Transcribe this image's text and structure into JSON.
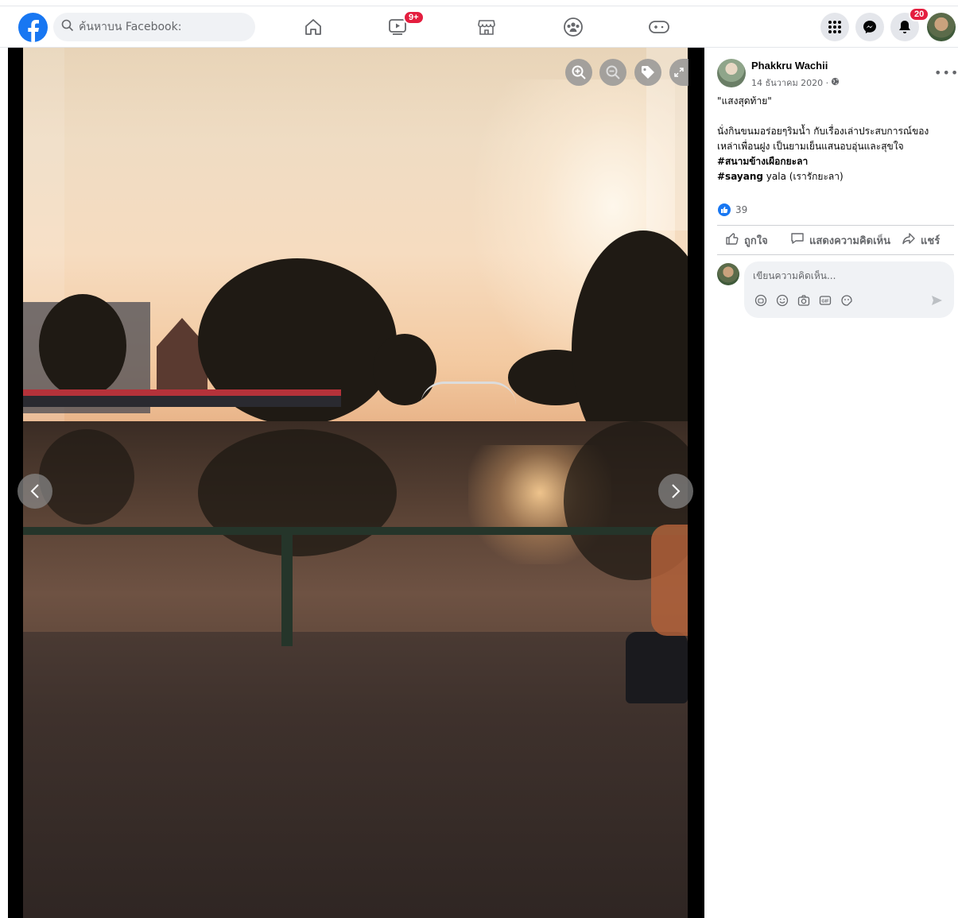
{
  "topbar": {
    "search_placeholder": "ค้นหาบน Facebook:",
    "watch_badge": "9+",
    "notifications_badge": "20",
    "accent_color": "#1877f2",
    "badge_color": "#e41e3f",
    "nav_icons": [
      "home-icon",
      "watch-icon",
      "marketplace-icon",
      "groups-icon",
      "gaming-icon"
    ],
    "right_icons": [
      "menu-grid-icon",
      "messenger-icon",
      "bell-icon",
      "profile-avatar"
    ]
  },
  "viewer": {
    "tools": [
      "zoom-in-icon",
      "zoom-out-icon",
      "tag-icon",
      "fullscreen-icon"
    ],
    "nav": [
      "previous-arrow-icon",
      "next-arrow-icon"
    ]
  },
  "post": {
    "author": "Phakkru Wachii",
    "date": "14 ธันวาคม 2020 ·",
    "title_line": "\"แสงสุดท้าย\"",
    "body_line1": "นั่งกินขนมอร่อยๆริมน้ำ กับเรื่องเล่าประสบการณ์ของ",
    "body_line2": "เหล่าเพื่อนฝูง เป็นยามเย็นแสนอบอุ่นและสุขใจ",
    "hashtag1": "#สนามข้างเผือกยะลา",
    "hashtag2_bold": "#sayang",
    "hashtag2_rest": " yala (เรารักยะลา)",
    "like_count": "39",
    "actions": {
      "like": "ถูกใจ",
      "comment": "แสดงความคิดเห็น",
      "share": "แชร์"
    },
    "comment_placeholder": "เขียนความคิดเห็น...",
    "comment_icons": [
      "avatar-sticker-icon",
      "emoji-icon",
      "camera-icon",
      "gif-icon",
      "sticker-icon"
    ]
  }
}
